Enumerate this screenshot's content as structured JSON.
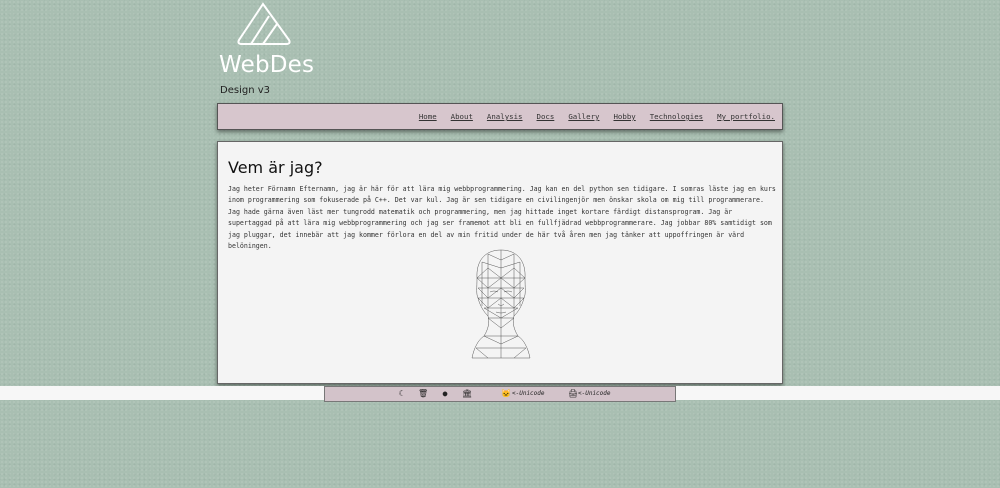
{
  "header": {
    "site_name": "WebDes",
    "subtitle": "Design v3"
  },
  "nav": {
    "items": [
      "Home",
      "Analysis",
      "Docs",
      "Gallery",
      "Hobby",
      "Technologies",
      "My portfolio."
    ],
    "about_label": "About"
  },
  "main": {
    "heading": "Vem är jag?",
    "body": "Jag heter Förnamn Efternamn, jag är här för att lära mig webbprogrammering. Jag kan en del python sen tidigare. I somras läste jag en kurs inom programmering som fokuserade på C++. Det var kul. Jag är sen tidigare en civilingenjör men önskar skola om mig till programmerare. Jag hade gärna även läst mer tungrodd matematik och programmering, men jag hittade inget kortare färdigt distansprogram. Jag är supertaggad på att lära mig webbprogrammering och jag ser framemot att bli en fullfjädrad webbprogrammerare. Jag jobbar 80% samtidigt som jag pluggar, det innebär att jag kommer förlora en del av min fritid under de här två åren men jag tänker att uppoffringen är värd belöningen.",
    "image_icon": "wireframe-head-bust"
  },
  "footer": {
    "icons": [
      "moon-icon",
      "trash-icon",
      "github-icon",
      "bank-icon"
    ],
    "unicode_label_1": "<-Unicode",
    "unicode_label_2": "<-Unicode",
    "unicode_icons": [
      "cat-emoji-icon",
      "printer-emoji-icon"
    ]
  },
  "colors": {
    "background": "#a9bfb2",
    "panel": "#d7c6cd",
    "content_bg": "#f4f4f4"
  }
}
